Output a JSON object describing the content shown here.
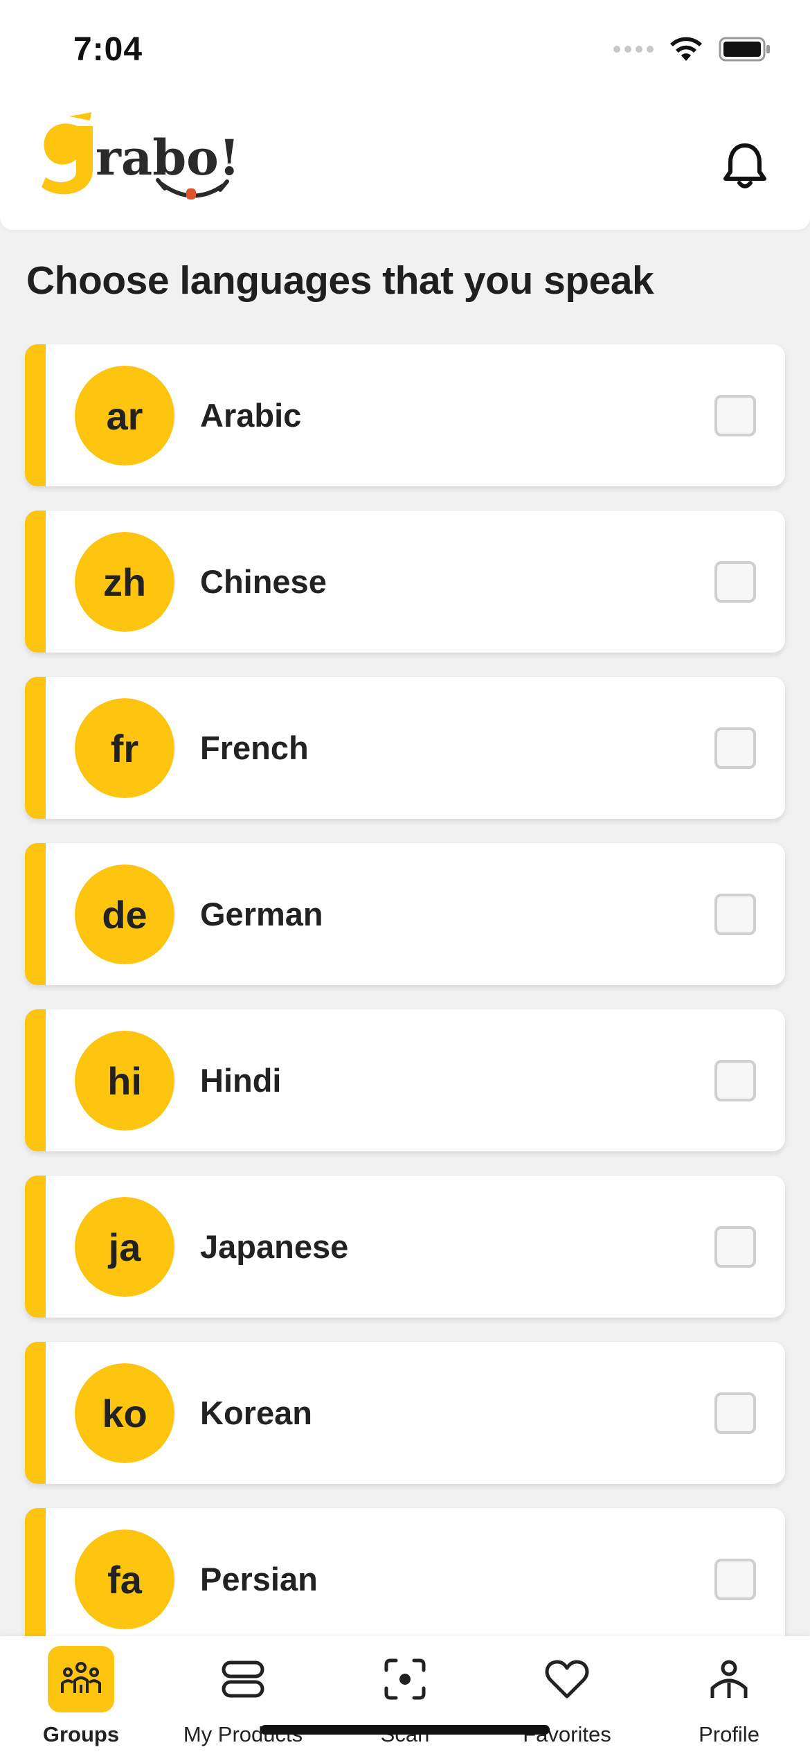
{
  "status_bar": {
    "time": "7:04"
  },
  "header": {
    "logo_icon": "grabo-logo",
    "notification_icon": "bell-icon"
  },
  "page_title": "Choose languages that you speak",
  "languages": [
    {
      "code": "ar",
      "name": "Arabic",
      "checked": false
    },
    {
      "code": "zh",
      "name": "Chinese",
      "checked": false
    },
    {
      "code": "fr",
      "name": "French",
      "checked": false
    },
    {
      "code": "de",
      "name": "German",
      "checked": false
    },
    {
      "code": "hi",
      "name": "Hindi",
      "checked": false
    },
    {
      "code": "ja",
      "name": "Japanese",
      "checked": false
    },
    {
      "code": "ko",
      "name": "Korean",
      "checked": false
    },
    {
      "code": "fa",
      "name": "Persian",
      "checked": false
    }
  ],
  "bottom_nav": {
    "items": [
      {
        "label": "Groups",
        "icon": "groups-icon",
        "active": true
      },
      {
        "label": "My Products",
        "icon": "products-icon",
        "active": false
      },
      {
        "label": "Scan",
        "icon": "scan-icon",
        "active": false
      },
      {
        "label": "Favorites",
        "icon": "heart-icon",
        "active": false
      },
      {
        "label": "Profile",
        "icon": "profile-icon",
        "active": false
      }
    ]
  },
  "colors": {
    "accent": "#fdc50f",
    "background": "#f1f1f1",
    "text": "#222222"
  }
}
